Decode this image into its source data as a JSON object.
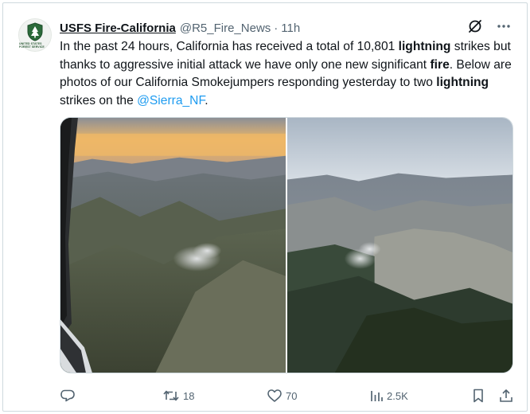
{
  "tweet": {
    "display_name": "USFS Fire-California",
    "handle": "@R5_Fire_News",
    "separator": "·",
    "time": "11h",
    "avatar_icon": "usfs-shield-logo",
    "avatar_caption": "UNITED STATES FOREST SERVICE",
    "body": {
      "t1": "In the past 24 hours, California has received a total of 10,801 ",
      "b1": "lightning",
      "t2": " strikes but thanks to aggressive initial attack we have only one new significant ",
      "b2": "fire",
      "t3": ". Below are photos of our California Smokejumpers responding yesterday to two ",
      "b3": "lightning",
      "t4": " strikes on the ",
      "mention": "@Sierra_NF",
      "t5": "."
    },
    "media": [
      {
        "icon": "aerial-photo-smoke-canyon"
      },
      {
        "icon": "aerial-photo-smoke-forest-ridge"
      }
    ],
    "actions": {
      "reply_count": "",
      "retweet_count": "18",
      "like_count": "70",
      "views_count": "2.5K"
    },
    "colors": {
      "text": "#0f1419",
      "secondary": "#536471",
      "link": "#1d9bf0",
      "border": "#cfd9de"
    }
  }
}
